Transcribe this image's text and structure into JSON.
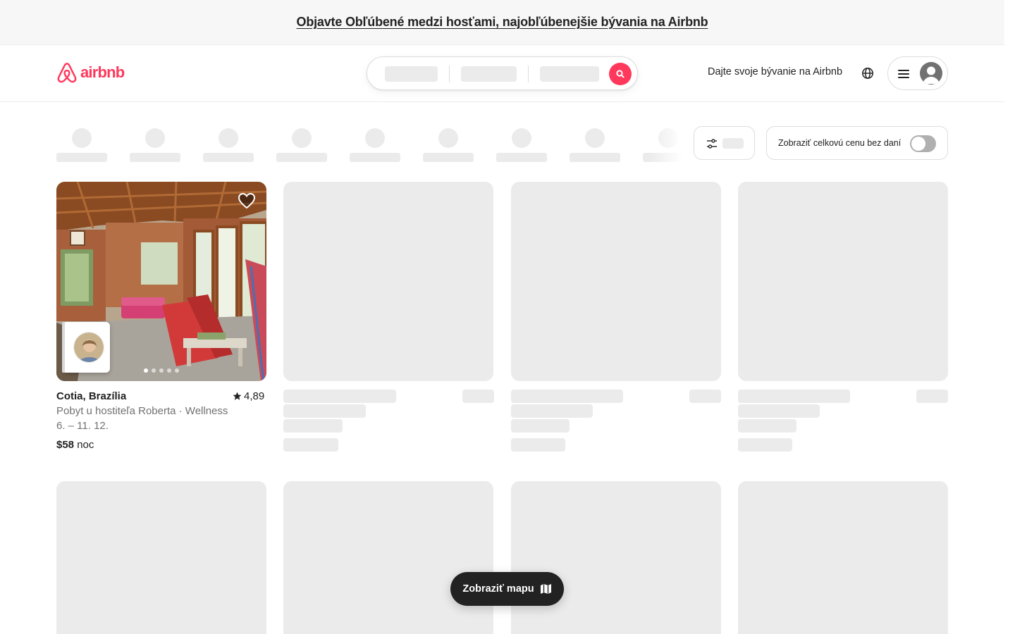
{
  "banner": {
    "text": "Objavte Obľúbené medzi hosťami, najobľúbenejšie bývania na Airbnb"
  },
  "header": {
    "logo_text": "airbnb",
    "host_link": "Dajte svoje bývanie na Airbnb",
    "icons": {
      "globe": "globe-icon",
      "menu": "hamburger-menu-icon",
      "avatar": "user-avatar-icon",
      "search": "search-icon"
    }
  },
  "filters": {
    "tax_toggle_label": "Zobraziť celkovú cenu bez daní",
    "tax_toggle_on": false
  },
  "listing": {
    "location": "Cotia, Brazília",
    "rating": "4,89",
    "subtitle": "Pobyt u hostiteľa Roberta · Wellness",
    "dates": "6. – 11. 12.",
    "price": "$58",
    "price_unit": "noc",
    "photo_count": 5,
    "active_photo": 1
  },
  "map_button": {
    "label": "Zobraziť mapu"
  },
  "colors": {
    "brand": "#ff385c",
    "text": "#222222",
    "muted": "#717171",
    "skeleton": "#ebebeb"
  }
}
